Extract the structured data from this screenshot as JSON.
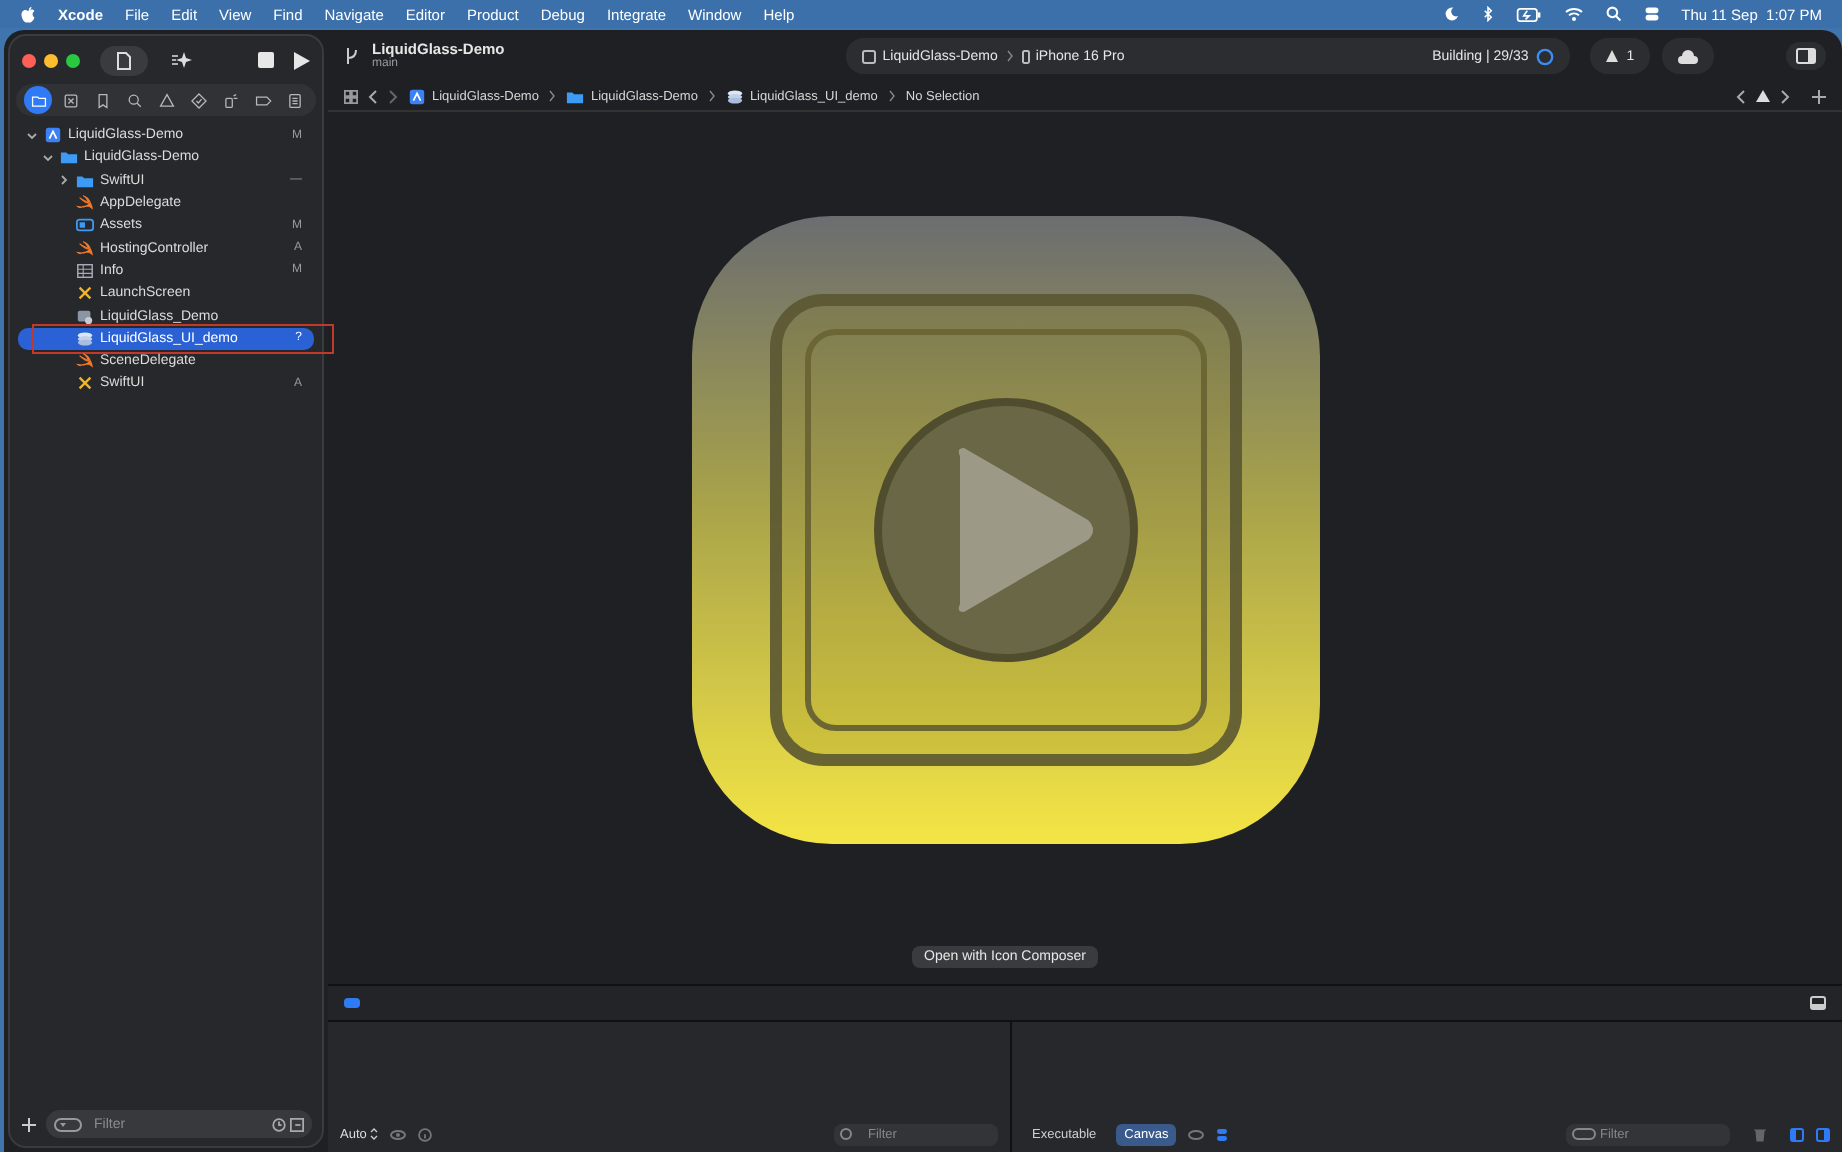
{
  "menu_bar": {
    "app": "Xcode",
    "menus": [
      "File",
      "Edit",
      "View",
      "Find",
      "Navigate",
      "Editor",
      "Product",
      "Debug",
      "Integrate",
      "Window",
      "Help"
    ],
    "clock": "Thu 11 Sep  1:07 PM"
  },
  "toolbar": {
    "navigator_shown": true,
    "project": "LiquidGlass-Demo",
    "branch": "main",
    "scheme": "LiquidGlass-Demo",
    "destination": "iPhone 16 Pro",
    "status": "Building | 29/33",
    "warnings": "1"
  },
  "navigator_tabs": [
    {
      "kind": "folder",
      "selected": true
    },
    {
      "kind": "source",
      "selected": false
    },
    {
      "kind": "bookmark",
      "selected": false
    },
    {
      "kind": "search",
      "selected": false
    },
    {
      "kind": "issue",
      "selected": false
    },
    {
      "kind": "test",
      "selected": false
    },
    {
      "kind": "debug",
      "selected": false
    },
    {
      "kind": "breakpoint",
      "selected": false
    },
    {
      "kind": "report",
      "selected": false
    }
  ],
  "tree": [
    {
      "name": "LiquidGlass-Demo",
      "kind": "project",
      "status": "M",
      "expanded": true,
      "selected": false,
      "outlined": false,
      "children": [
        {
          "name": "LiquidGlass-Demo",
          "kind": "folder",
          "expanded": true,
          "selected": false,
          "outlined": false,
          "children": [
            {
              "name": "SwiftUI",
              "kind": "folder",
              "status": "—",
              "expanded": false,
              "selected": false,
              "outlined": false
            },
            {
              "name": "AppDelegate",
              "kind": "swift",
              "selected": false,
              "outlined": false
            },
            {
              "name": "Assets",
              "kind": "assets",
              "status": "M",
              "selected": false,
              "outlined": false
            },
            {
              "name": "HostingController",
              "kind": "swift",
              "status": "A",
              "selected": false,
              "outlined": false
            },
            {
              "name": "Info",
              "kind": "plist",
              "status": "M",
              "selected": false,
              "outlined": false
            },
            {
              "name": "LaunchScreen",
              "kind": "storyboard",
              "selected": false,
              "outlined": false
            },
            {
              "name": "LiquidGlass_Demo",
              "kind": "entitlements",
              "selected": false,
              "outlined": false
            },
            {
              "name": "LiquidGlass_UI_demo",
              "kind": "icon",
              "status": "?",
              "selected": true,
              "outlined": true
            },
            {
              "name": "SceneDelegate",
              "kind": "swift",
              "selected": false,
              "outlined": false
            },
            {
              "name": "SwiftUI",
              "kind": "storyboard",
              "status": "A",
              "selected": false,
              "outlined": false
            }
          ]
        }
      ]
    }
  ],
  "navigator_filter": {
    "placeholder": "Filter"
  },
  "jump_bar": [
    {
      "label": "LiquidGlass-Demo",
      "kind": "project"
    },
    {
      "label": "LiquidGlass-Demo",
      "kind": "folder"
    },
    {
      "label": "LiquidGlass_UI_demo",
      "kind": "icon"
    },
    {
      "label": "No Selection",
      "kind": "none"
    }
  ],
  "preview": {
    "button": "Open with Icon Composer"
  },
  "debug": {
    "console_shown": true,
    "scope": "Auto",
    "variables_filter": {
      "placeholder": "Filter"
    },
    "console_scopes": [
      {
        "label": "Executable",
        "selected": false
      },
      {
        "label": "Canvas",
        "selected": true
      }
    ],
    "console_filter": {
      "placeholder": "Filter"
    }
  }
}
